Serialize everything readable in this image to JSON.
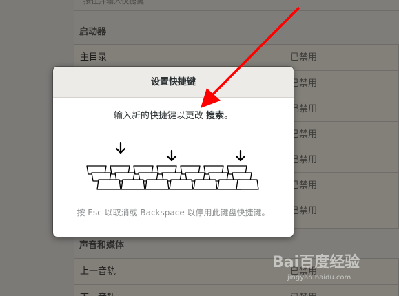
{
  "background": {
    "top_row_partial_text": "按住并输入快捷键",
    "launchers_section": {
      "title": "启动器",
      "rows": [
        {
          "label": "主目录",
          "status": "已禁用"
        },
        {
          "label": "",
          "status": "已禁用"
        },
        {
          "label": "",
          "status": "已禁用"
        },
        {
          "label": "",
          "status": "已禁用"
        },
        {
          "label": "",
          "status": "已禁用"
        },
        {
          "label": "",
          "status": "已禁用"
        },
        {
          "label": "",
          "status": "已禁用"
        }
      ]
    },
    "media_section": {
      "title": "声音和媒体",
      "rows": [
        {
          "label": "上一音轨",
          "status": "已禁用"
        },
        {
          "label": "下一音轨",
          "status": "已禁用"
        }
      ]
    }
  },
  "dialog": {
    "title": "设置快捷键",
    "instruction_prefix": "输入新的快捷键以更改 ",
    "instruction_target": "搜索",
    "instruction_suffix": "。",
    "hint": "按 Esc 以取消或 Backspace 以停用此键盘快捷键。"
  },
  "watermark": {
    "logo": "Bai百度经验",
    "url": "jingyan.baidu.com"
  },
  "colors": {
    "annotation_arrow": "#ff0000",
    "dialog_header_bg": "#edebe8",
    "overlay_bg": "#7d7b78"
  }
}
